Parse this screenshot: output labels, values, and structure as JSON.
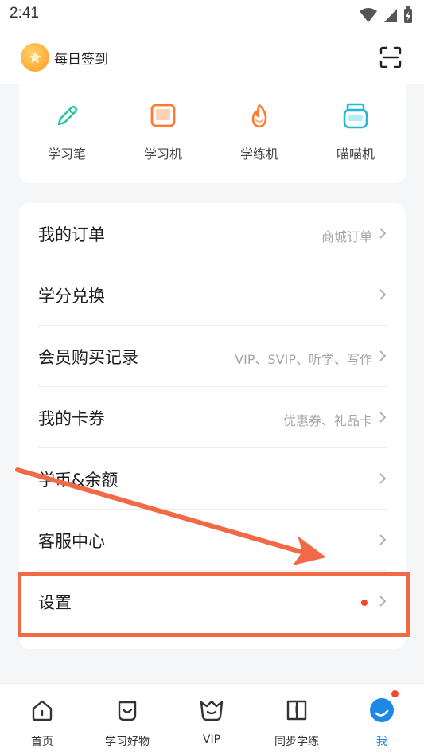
{
  "status_bar": {
    "time": "2:41"
  },
  "header": {
    "checkin_label": "每日签到"
  },
  "devices": [
    {
      "label": "学习笔",
      "icon": "pen-icon"
    },
    {
      "label": "学习机",
      "icon": "tablet-icon"
    },
    {
      "label": "学练机",
      "icon": "flame-icon"
    },
    {
      "label": "喵喵机",
      "icon": "printer-icon"
    }
  ],
  "menu": [
    {
      "title": "我的订单",
      "sub": "商城订单"
    },
    {
      "title": "学分兑换",
      "sub": ""
    },
    {
      "title": "会员购买记录",
      "sub": "VIP、SVIP、听学、写作"
    },
    {
      "title": "我的卡券",
      "sub": "优惠券、礼品卡"
    },
    {
      "title": "学币&余额",
      "sub": ""
    },
    {
      "title": "客服中心",
      "sub": ""
    },
    {
      "title": "设置",
      "sub": ""
    }
  ],
  "nav": [
    {
      "label": "首页",
      "icon": "home-icon"
    },
    {
      "label": "学习好物",
      "icon": "shop-icon"
    },
    {
      "label": "VIP",
      "icon": "vip-icon"
    },
    {
      "label": "同步学练",
      "icon": "book-icon"
    },
    {
      "label": "我",
      "icon": "profile-icon"
    }
  ],
  "colors": {
    "accent_blue": "#1e88e5",
    "highlight_orange": "#f26a45",
    "badge_red": "#f4472d",
    "device_green": "#2cc6a2",
    "device_orange": "#ff7a2e",
    "device_teal": "#22b8d6"
  }
}
